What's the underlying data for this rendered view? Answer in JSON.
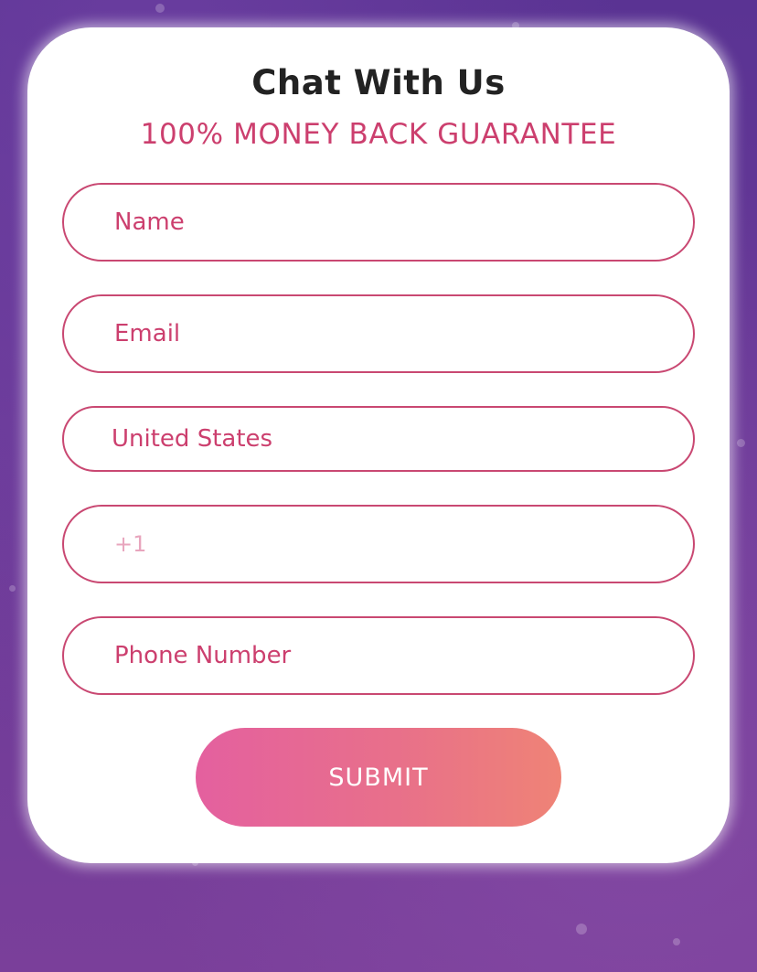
{
  "form": {
    "title": "Chat With Us",
    "subtitle": "100% MONEY BACK GUARANTEE",
    "name_placeholder": "Name",
    "email_placeholder": "Email",
    "country_value": "United States",
    "dial_code_placeholder": "+1",
    "phone_placeholder": "Phone Number",
    "submit_label": "SUBMIT"
  },
  "colors": {
    "accent": "#cc3f6e",
    "background": "#6a3a98",
    "button_gradient_start": "#e4609f",
    "button_gradient_end": "#ef8376"
  }
}
